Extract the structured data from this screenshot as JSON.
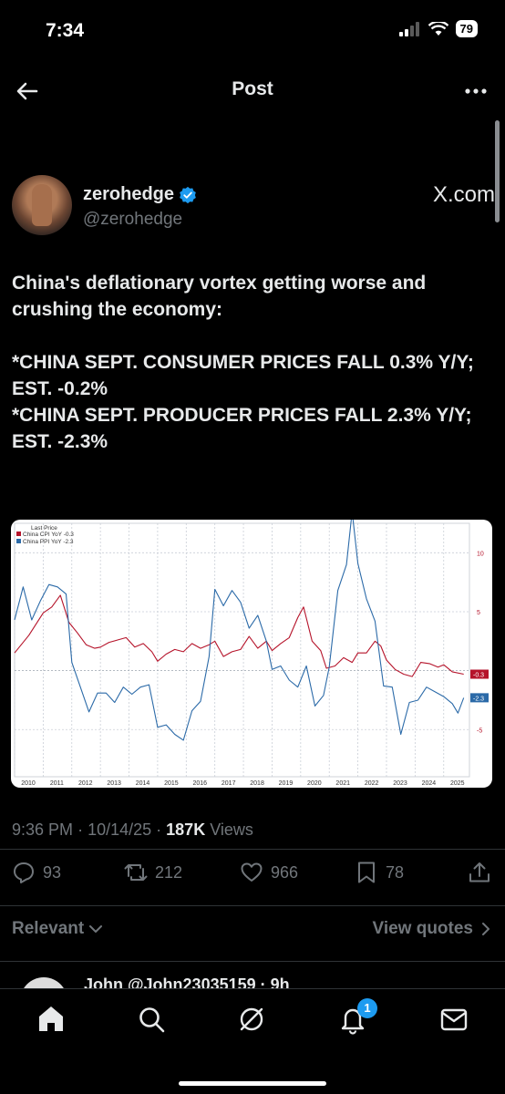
{
  "status_bar": {
    "time": "7:34",
    "battery": "79"
  },
  "nav": {
    "title": "Post"
  },
  "author": {
    "display_name": "zerohedge",
    "handle": "@zerohedge",
    "source_logo": "X.com",
    "verified": true
  },
  "tweet": {
    "lines": [
      "China's deflationary vortex getting worse and crushing the economy:",
      "",
      "*CHINA SEPT. CONSUMER PRICES FALL 0.3% Y/Y; EST. -0.2%",
      "*CHINA SEPT. PRODUCER PRICES FALL 2.3% Y/Y; EST. -2.3%"
    ]
  },
  "chart_data": {
    "type": "line",
    "legend_title": "Last Price",
    "legend_position": "top-left",
    "grid": true,
    "x_ticks": [
      "2010",
      "2011",
      "2012",
      "2013",
      "2014",
      "2015",
      "2016",
      "2017",
      "2018",
      "2019",
      "2020",
      "2021",
      "2022",
      "2023",
      "2024",
      "2025"
    ],
    "y_ticks": [
      "10",
      "5",
      "-5"
    ],
    "ylim": [
      -9,
      12.5
    ],
    "xlim": [
      2010,
      2025.9
    ],
    "series": [
      {
        "name": "China CPI YoY",
        "last": "-0.3",
        "color": "#b5132a",
        "x": [
          2010,
          2010.5,
          2011,
          2011.3,
          2011.6,
          2011.9,
          2012.2,
          2012.5,
          2012.8,
          2013,
          2013.3,
          2013.6,
          2013.9,
          2014.2,
          2014.5,
          2014.8,
          2015,
          2015.3,
          2015.6,
          2015.9,
          2016.2,
          2016.5,
          2016.8,
          2017,
          2017.3,
          2017.6,
          2017.9,
          2018.2,
          2018.5,
          2018.8,
          2019,
          2019.3,
          2019.6,
          2019.9,
          2020.1,
          2020.4,
          2020.7,
          2020.9,
          2021.2,
          2021.5,
          2021.8,
          2022,
          2022.3,
          2022.6,
          2022.8,
          2023,
          2023.3,
          2023.6,
          2023.9,
          2024.2,
          2024.5,
          2024.8,
          2025,
          2025.3,
          2025.7
        ],
        "y": [
          1.5,
          3.0,
          4.9,
          5.4,
          6.4,
          4.1,
          3.2,
          2.2,
          1.9,
          2.0,
          2.4,
          2.6,
          2.8,
          2.0,
          2.3,
          1.6,
          0.8,
          1.4,
          1.8,
          1.6,
          2.3,
          1.9,
          2.2,
          2.5,
          1.2,
          1.6,
          1.8,
          2.9,
          1.9,
          2.5,
          1.7,
          2.3,
          2.8,
          4.5,
          5.4,
          2.5,
          1.7,
          0.2,
          0.4,
          1.1,
          0.7,
          1.5,
          1.5,
          2.5,
          2.1,
          0.9,
          0.1,
          -0.3,
          -0.5,
          0.7,
          0.6,
          0.3,
          0.5,
          -0.1,
          -0.3
        ]
      },
      {
        "name": "China PPI YoY",
        "last": "-2.3",
        "color": "#2b6aa8",
        "x": [
          2010,
          2010.3,
          2010.6,
          2010.9,
          2011.2,
          2011.5,
          2011.8,
          2012,
          2012.3,
          2012.6,
          2012.9,
          2013.2,
          2013.5,
          2013.8,
          2014.1,
          2014.4,
          2014.7,
          2015,
          2015.3,
          2015.6,
          2015.9,
          2016.2,
          2016.5,
          2016.8,
          2017,
          2017.3,
          2017.6,
          2017.9,
          2018.2,
          2018.5,
          2018.8,
          2019,
          2019.3,
          2019.6,
          2019.9,
          2020.2,
          2020.5,
          2020.8,
          2021,
          2021.3,
          2021.6,
          2021.8,
          2022,
          2022.3,
          2022.6,
          2022.9,
          2023.2,
          2023.5,
          2023.8,
          2024.1,
          2024.4,
          2024.7,
          2025,
          2025.3,
          2025.5,
          2025.7
        ],
        "y": [
          4.3,
          7.1,
          4.3,
          5.9,
          7.3,
          7.1,
          6.5,
          0.7,
          -1.4,
          -3.5,
          -1.9,
          -1.9,
          -2.7,
          -1.4,
          -2.0,
          -1.4,
          -1.2,
          -4.8,
          -4.6,
          -5.4,
          -5.9,
          -3.4,
          -2.6,
          1.2,
          6.9,
          5.5,
          6.8,
          5.8,
          3.6,
          4.7,
          2.5,
          0.1,
          0.4,
          -0.8,
          -1.4,
          0.4,
          -3.0,
          -2.1,
          0.3,
          6.8,
          9.0,
          13.5,
          9.1,
          6.1,
          4.2,
          -1.3,
          -1.4,
          -5.4,
          -2.7,
          -2.5,
          -1.4,
          -1.8,
          -2.2,
          -2.8,
          -3.6,
          -2.3
        ]
      }
    ]
  },
  "meta": {
    "time": "9:36 PM",
    "date": "10/14/25",
    "views": "187K",
    "views_label": "Views"
  },
  "actions": {
    "replies": "93",
    "reposts": "212",
    "likes": "966",
    "bookmarks": "78"
  },
  "filter": {
    "relevant": "Relevant",
    "view_quotes": "View quotes"
  },
  "reply_peek": {
    "text": "John @John23035159 · 9h"
  },
  "tab_bar": {
    "notification_badge": "1"
  },
  "colors": {
    "accent": "#1d9bf0",
    "muted": "#71767b",
    "text": "#e7e9ea"
  }
}
